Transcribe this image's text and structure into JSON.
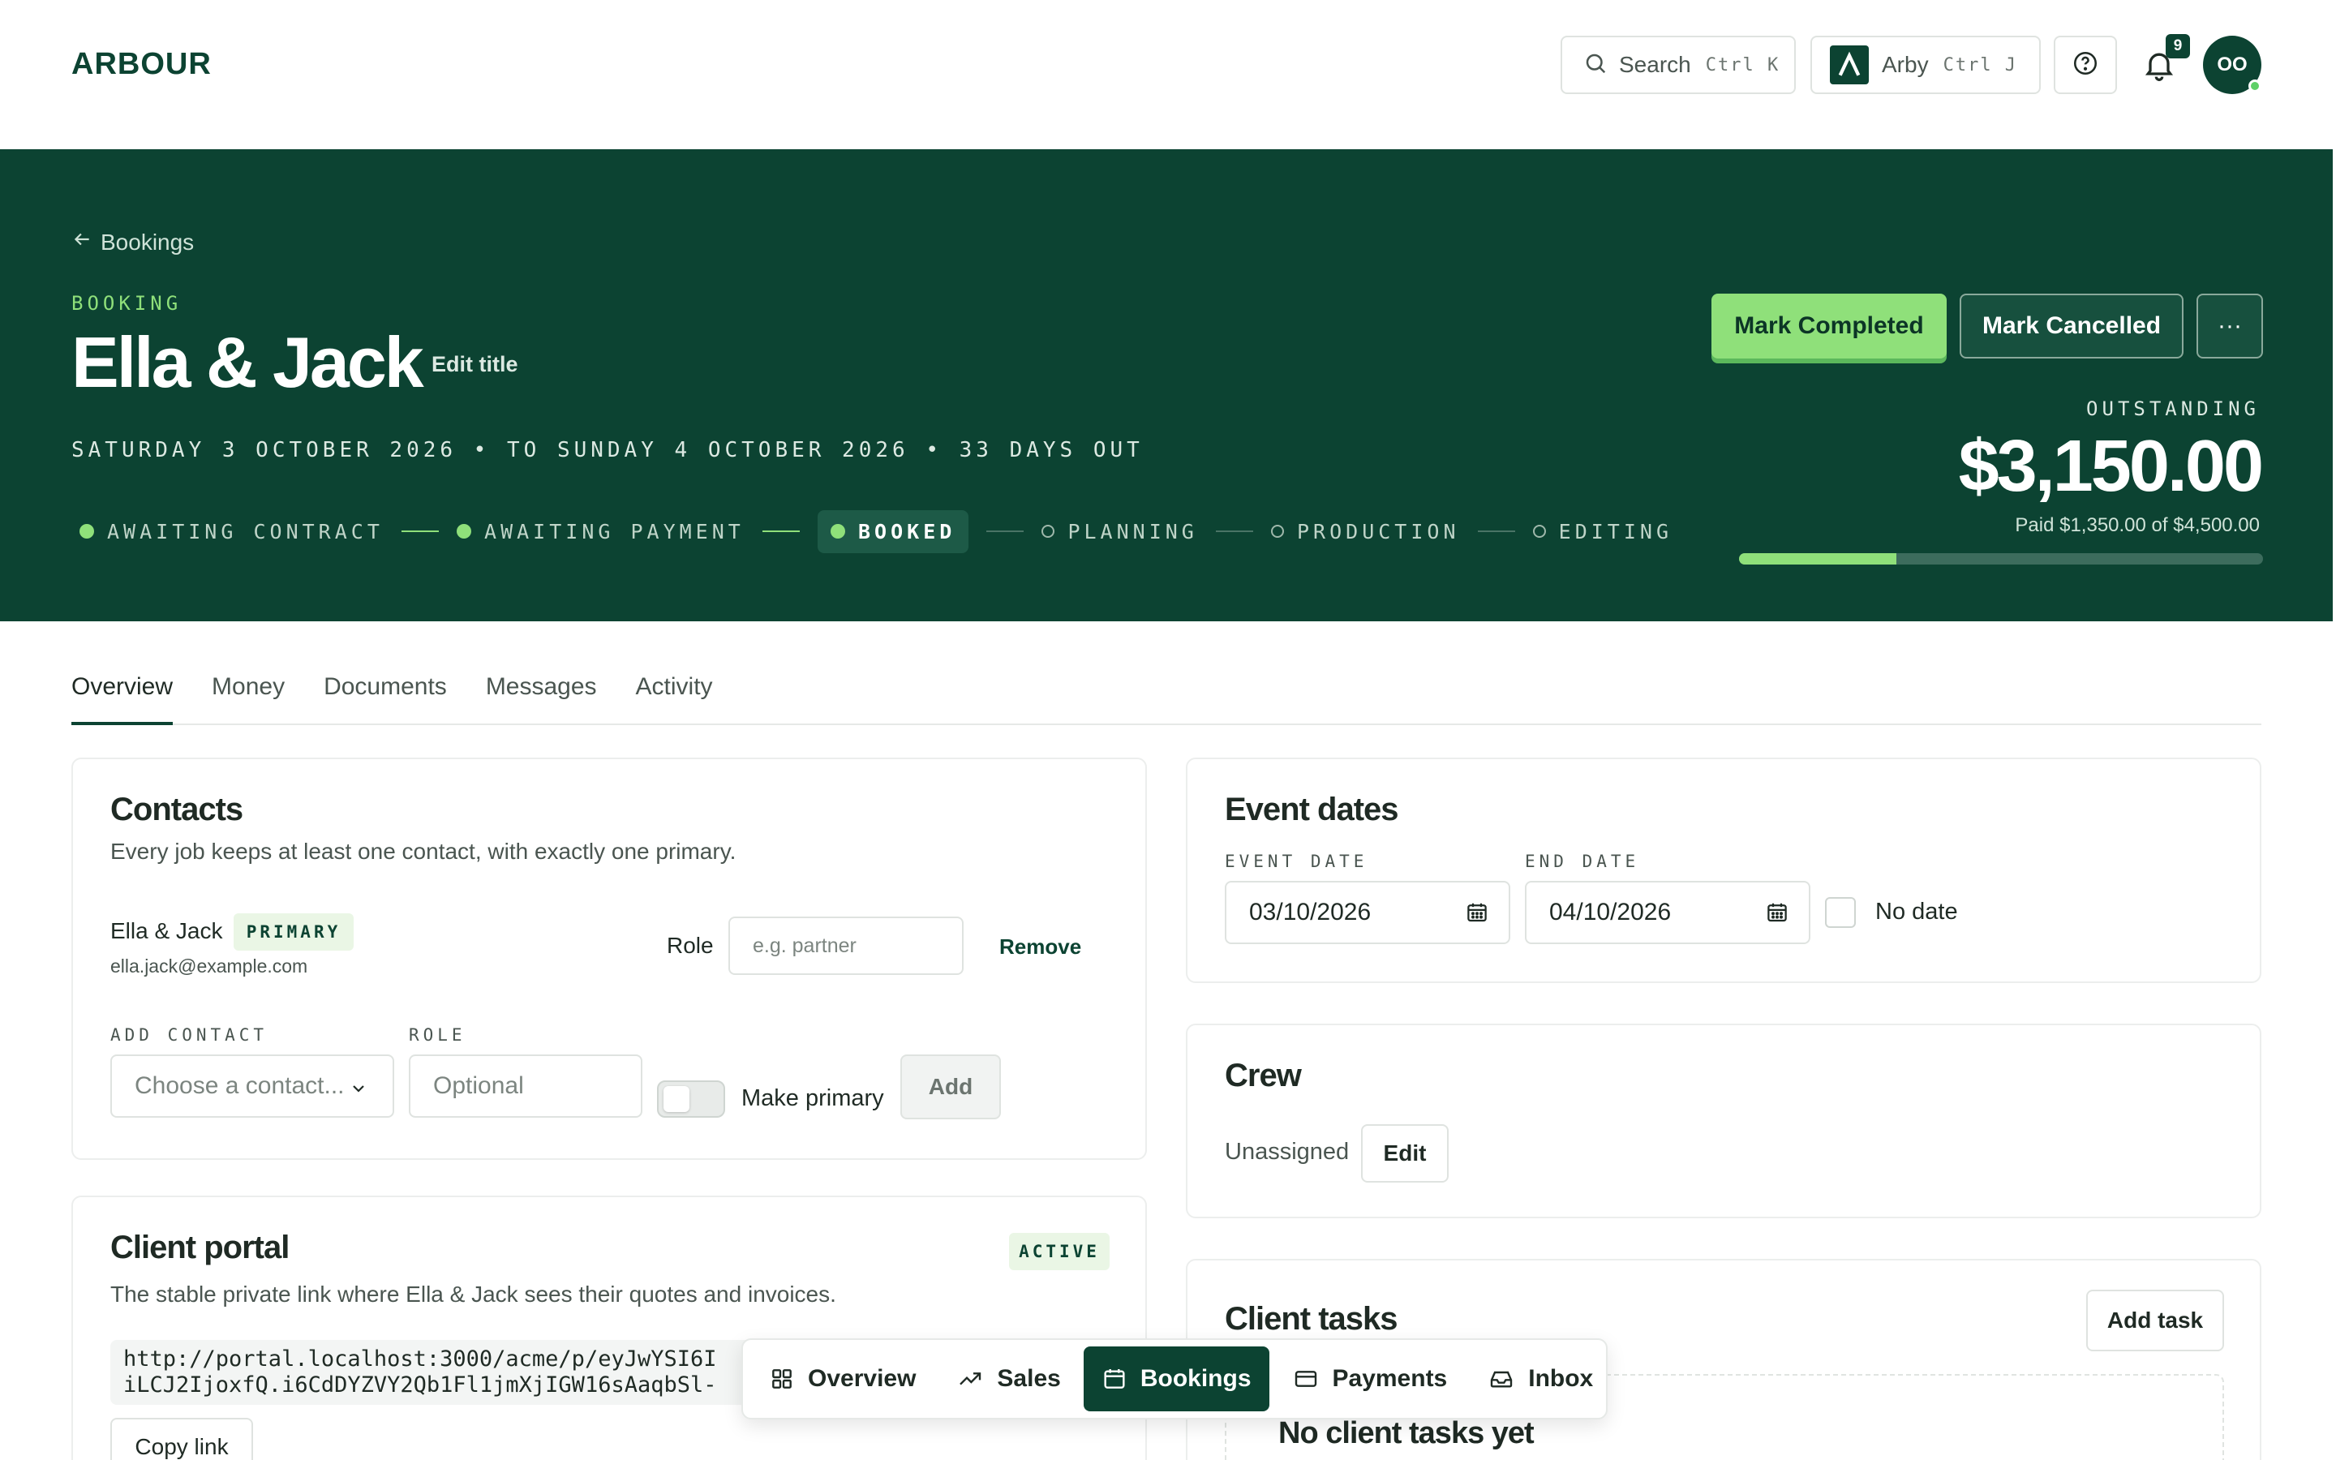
{
  "app": {
    "logo": "ARBOUR",
    "search_label": "Search",
    "search_shortcut": "Ctrl K",
    "assistant_label": "Arby",
    "assistant_shortcut": "Ctrl J",
    "notification_count": "9",
    "avatar_initials": "OO"
  },
  "hero": {
    "back_label": "Bookings",
    "kicker": "BOOKING",
    "title": "Ella & Jack",
    "edit_title": "Edit title",
    "dates_line": "SATURDAY 3 OCTOBER 2026 • TO SUNDAY 4 OCTOBER 2026 • 33 DAYS OUT",
    "stages": [
      {
        "label": "AWAITING CONTRACT",
        "state": "done"
      },
      {
        "label": "AWAITING PAYMENT",
        "state": "done"
      },
      {
        "label": "BOOKED",
        "state": "current"
      },
      {
        "label": "PLANNING",
        "state": "todo"
      },
      {
        "label": "PRODUCTION",
        "state": "todo"
      },
      {
        "label": "EDITING",
        "state": "todo"
      }
    ],
    "mark_completed": "Mark Completed",
    "mark_cancelled": "Mark Cancelled",
    "more": "···",
    "outstanding_label": "OUTSTANDING",
    "outstanding_amount": "$3,150.00",
    "paid_text": "Paid $1,350.00 of $4,500.00",
    "paid_fraction": 0.3
  },
  "tabs": [
    "Overview",
    "Money",
    "Documents",
    "Messages",
    "Activity"
  ],
  "contacts": {
    "title": "Contacts",
    "subtitle": "Every job keeps at least one contact, with exactly one primary.",
    "contact_name": "Ella & Jack",
    "primary_badge": "PRIMARY",
    "contact_email": "ella.jack@example.com",
    "role_label": "Role",
    "role_placeholder": "e.g. partner",
    "remove": "Remove",
    "add_contact_label": "ADD CONTACT",
    "role_field_label": "ROLE",
    "choose_contact": "Choose a contact...",
    "optional_placeholder": "Optional",
    "make_primary": "Make primary",
    "add": "Add"
  },
  "event_dates": {
    "title": "Event dates",
    "event_date_label": "EVENT DATE",
    "end_date_label": "END DATE",
    "event_date": "03/10/2026",
    "end_date": "04/10/2026",
    "no_date": "No date"
  },
  "crew": {
    "title": "Crew",
    "status": "Unassigned",
    "edit": "Edit"
  },
  "client_portal": {
    "title": "Client portal",
    "badge": "ACTIVE",
    "subtitle": "The stable private link where Ella & Jack sees their quotes and invoices.",
    "url_line1": "http://portal.localhost:3000/acme/p/eyJwYSI6I",
    "url_line2": "iLCJ2IjoxfQ.i6CdDYZVY2Qb1Fl1jmXjIGW16sAaqbSl-",
    "copy_link": "Copy link"
  },
  "client_tasks": {
    "title": "Client tasks",
    "add_task": "Add task",
    "empty": "No client tasks yet"
  },
  "floating_nav": [
    {
      "label": "Overview",
      "icon": "grid-icon"
    },
    {
      "label": "Sales",
      "icon": "trend-icon"
    },
    {
      "label": "Bookings",
      "icon": "calendar-icon",
      "active": true
    },
    {
      "label": "Payments",
      "icon": "card-icon"
    },
    {
      "label": "Inbox",
      "icon": "inbox-icon"
    }
  ],
  "colors": {
    "brand": "#0c4332",
    "accent": "#8fe07a"
  }
}
